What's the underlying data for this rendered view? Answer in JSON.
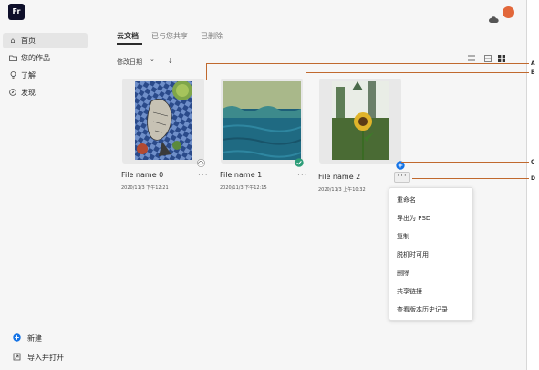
{
  "app": {
    "logo_text": "Fr"
  },
  "sidebar": {
    "items": [
      {
        "label": "首页",
        "icon": "home-icon"
      },
      {
        "label": "您的作品",
        "icon": "folder-icon"
      },
      {
        "label": "了解",
        "icon": "lightbulb-icon"
      },
      {
        "label": "发现",
        "icon": "compass-icon"
      }
    ],
    "new_label": "新建",
    "import_label": "导入并打开"
  },
  "tabs": [
    {
      "label": "云文档",
      "active": true
    },
    {
      "label": "已与您共享",
      "active": false
    },
    {
      "label": "已删除",
      "active": false
    }
  ],
  "sort": {
    "label": "修改日期",
    "chevron": "⌄",
    "arrow": "↓"
  },
  "files": [
    {
      "name": "File name 0",
      "date": "2020/11/3 下午12:21",
      "status_icon": "cloud-sync-icon"
    },
    {
      "name": "File name 1",
      "date": "2020/11/3 下午12:15",
      "status_icon": "check-icon"
    },
    {
      "name": "File name  2",
      "date": "2020/11/3 上午10:32",
      "status_icon": "plus-icon"
    }
  ],
  "more_label": "···",
  "context_menu": [
    "重命名",
    "导出为 PSD",
    "复制",
    "脱机时可用",
    "删除",
    "共享链接",
    "查看版本历史记录"
  ],
  "callouts": [
    "A",
    "B",
    "C",
    "D"
  ],
  "colors": {
    "accent": "#1473e6",
    "callout": "#c0692e",
    "avatar": "#e2673a",
    "check": "#2d9d78"
  }
}
